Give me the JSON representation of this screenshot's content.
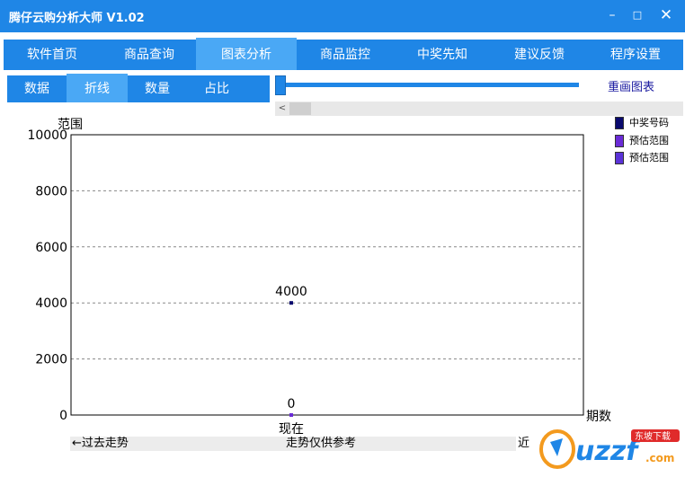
{
  "window": {
    "title": "腾仔云购分析大师 V1.02",
    "min_icon": "minimize-icon",
    "max_icon": "maximize-icon",
    "close_icon": "close-icon"
  },
  "menu": {
    "items": [
      "软件首页",
      "商品查询",
      "图表分析",
      "商品监控",
      "中奖先知",
      "建议反馈",
      "程序设置"
    ],
    "active": "图表分析"
  },
  "subtabs": {
    "items": [
      "数据",
      "折线",
      "数量",
      "占比"
    ],
    "active": "折线"
  },
  "controls": {
    "redraw_label": "重画图表",
    "slider_value": 0
  },
  "legend": [
    {
      "label": "中奖号码",
      "color": "#0a0a6e"
    },
    {
      "label": "预估范围",
      "color": "#6a2bd6"
    },
    {
      "label": "预估范围",
      "color": "#5b33d8"
    }
  ],
  "chart_data": {
    "type": "line",
    "ylabel": "范围",
    "xlabel": "期数",
    "ylim": [
      0,
      10000
    ],
    "yticks": [
      0,
      2000,
      4000,
      6000,
      8000,
      10000
    ],
    "categories": [
      "现在"
    ],
    "grid": true,
    "legend_position": "right",
    "series": [
      {
        "name": "中奖号码",
        "values": [
          4000
        ],
        "labels": [
          "4000"
        ]
      },
      {
        "name": "预估范围",
        "values": [
          0
        ],
        "labels": [
          "0"
        ]
      }
    ]
  },
  "bottom": {
    "left_label": "←过去走势",
    "mid_label": "走势仅供参考",
    "right_label": "近"
  },
  "watermark": {
    "brand": "uzzf",
    "domain": ".com",
    "tag": "东坡下载"
  }
}
